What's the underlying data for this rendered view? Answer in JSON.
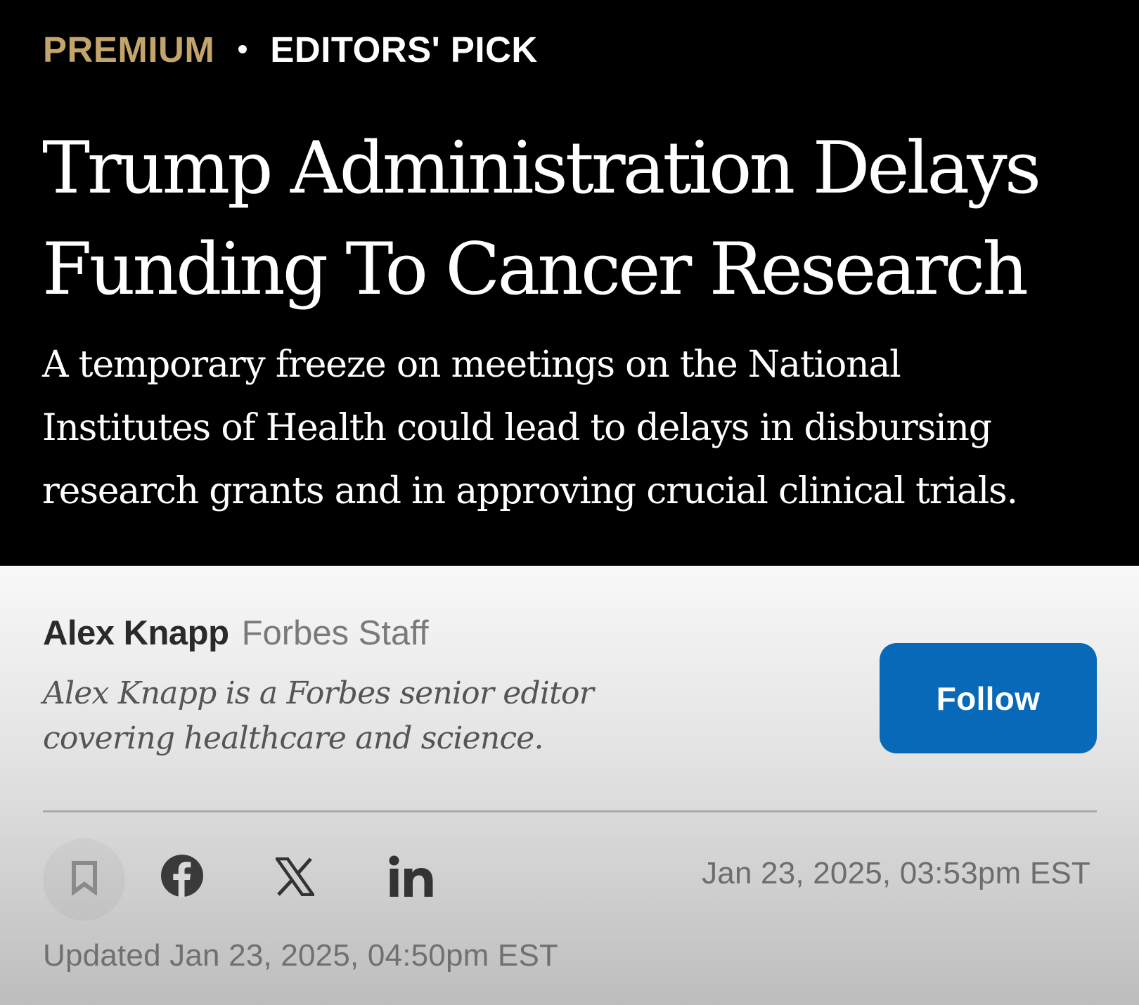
{
  "article": {
    "labels": {
      "premium": "PREMIUM",
      "editors_pick": "EDITORS' PICK"
    },
    "headline_lines": [
      "Trump Administration Delays",
      "Funding To Cancer Research"
    ],
    "dek_lines": [
      "A temporary freeze on meetings on the National",
      "Institutes of Health could lead to delays in disbursing",
      "research grants and in approving crucial clinical trials."
    ]
  },
  "author": {
    "name": "Alex Knapp",
    "role": "Forbes Staff",
    "bio_lines": [
      "Alex Knapp is a Forbes senior editor",
      "covering healthcare and science."
    ],
    "follow_label": "Follow"
  },
  "share": {
    "icons": [
      "bookmark-icon",
      "facebook-icon",
      "x-icon",
      "linkedin-icon"
    ]
  },
  "dates": {
    "published": "Jan 23, 2025,  03:53pm EST",
    "updated": "Updated Jan 23, 2025, 04:50pm EST"
  },
  "colors": {
    "premium_gold": "#c3a56b",
    "follow_blue": "#0769b8",
    "hero_background": "#000000"
  }
}
